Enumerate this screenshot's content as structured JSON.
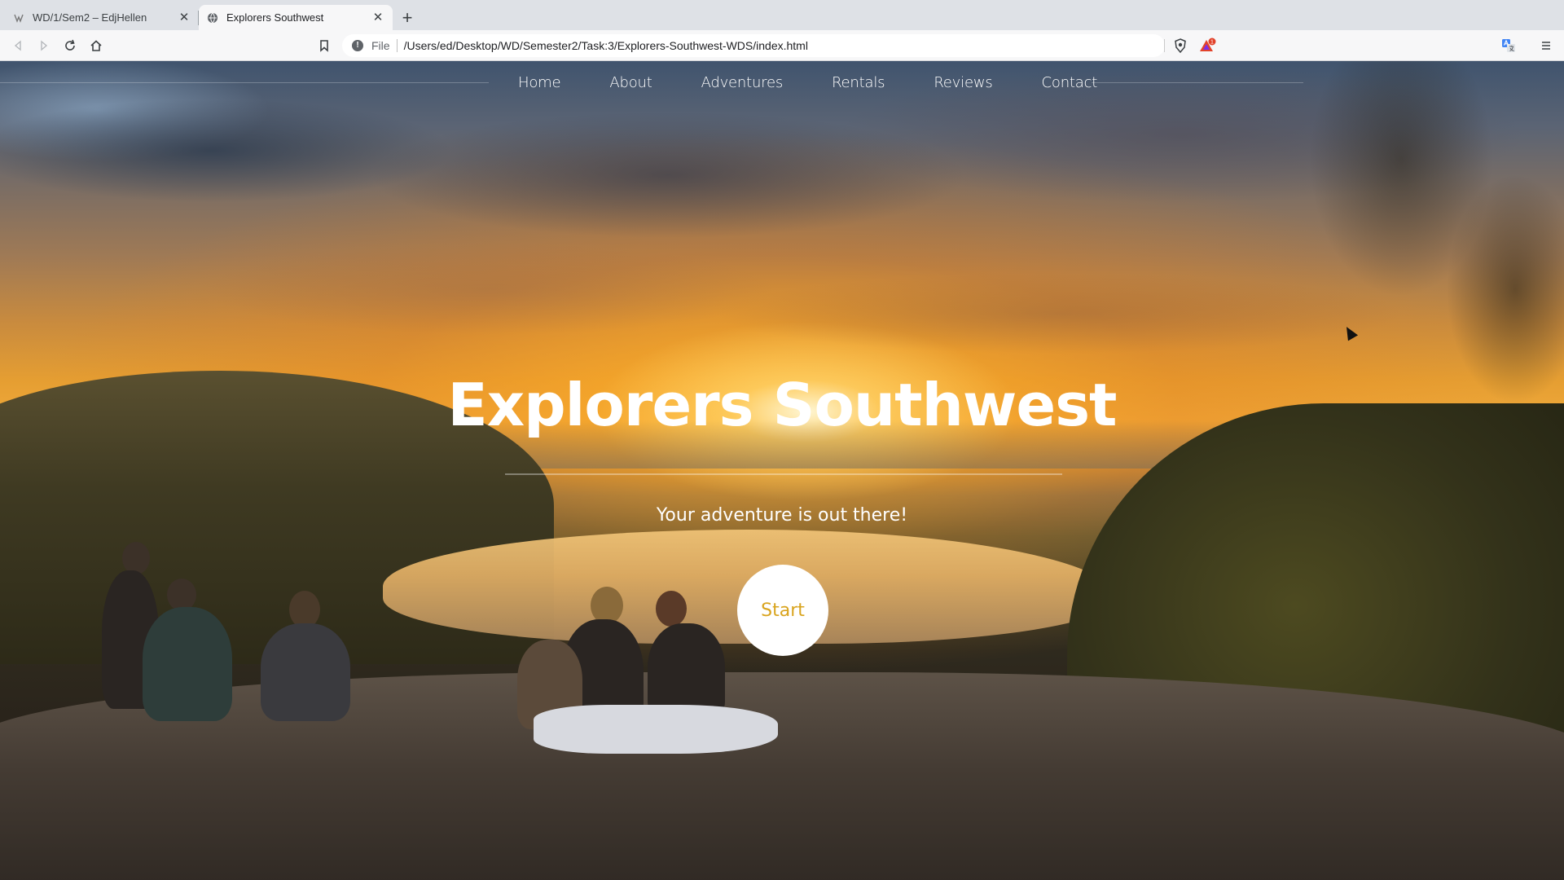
{
  "browser": {
    "tabs": [
      {
        "title": "WD/1/Sem2 – EdjHellen",
        "active": false
      },
      {
        "title": "Explorers Southwest",
        "active": true
      }
    ],
    "close_glyph": "✕",
    "new_tab_glyph": "+",
    "address": {
      "scheme": "File",
      "url": "/Users/ed/Desktop/WD/Semester2/Task:3/Explorers-Southwest-WDS/index.html"
    },
    "icons": [
      "back-icon",
      "forward-icon",
      "reload-icon",
      "home-icon",
      "bookmark-icon",
      "info-icon",
      "brave-shield-icon",
      "brave-rewards-icon",
      "translate-icon",
      "menu-icon"
    ],
    "notification_badge": "1"
  },
  "site": {
    "nav": [
      "Home",
      "About",
      "Adventures",
      "Rentals",
      "Reviews",
      "Contact"
    ],
    "hero": {
      "title": "Explorers Southwest",
      "subtitle": "Your adventure is out there!",
      "cta": "Start"
    },
    "colors": {
      "cta_text": "#d9a41e",
      "cta_background": "#ffffff",
      "nav_text": "#ffffff"
    }
  }
}
